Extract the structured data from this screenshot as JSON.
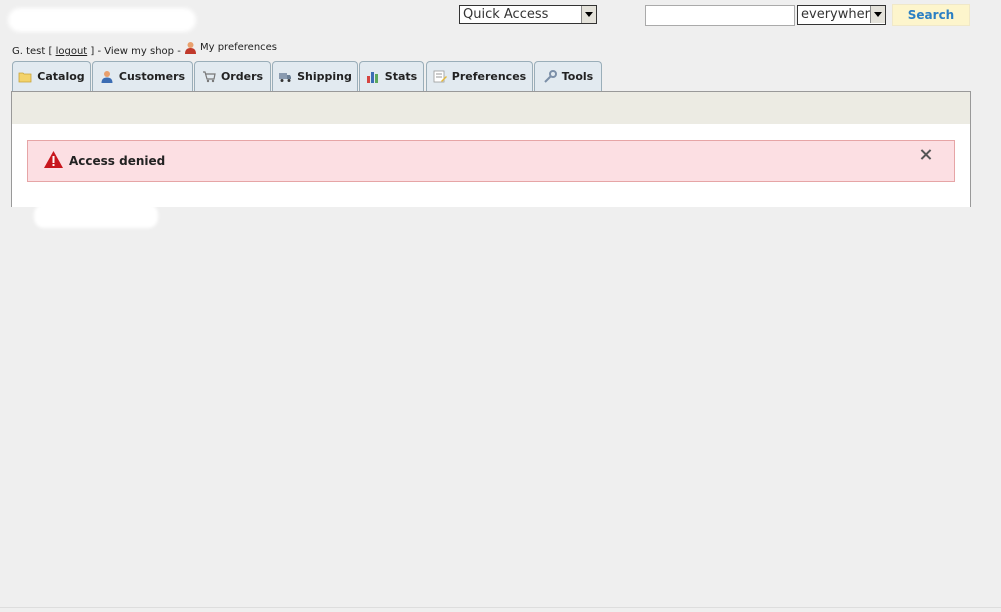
{
  "header": {
    "user_name": "G. test",
    "logout_label": "logout",
    "view_shop_label": "View my shop",
    "preferences_label": "My preferences"
  },
  "quick_access": {
    "value": "Quick Access"
  },
  "search": {
    "value": "",
    "scope": "everywhere",
    "button_label": "Search"
  },
  "tabs": [
    {
      "label": "Catalog",
      "icon": "folder-icon"
    },
    {
      "label": "Customers",
      "icon": "customer-icon"
    },
    {
      "label": "Orders",
      "icon": "cart-icon"
    },
    {
      "label": "Shipping",
      "icon": "truck-icon"
    },
    {
      "label": "Stats",
      "icon": "bar-chart-icon"
    },
    {
      "label": "Preferences",
      "icon": "settings-sheet-icon"
    },
    {
      "label": "Tools",
      "icon": "wrench-icon"
    }
  ],
  "alert": {
    "message": "Access denied",
    "icon": "warning-triangle-icon"
  },
  "colors": {
    "search_button_text": "#2a7fc4",
    "alert_bg": "#fcdfe3",
    "tab_bg": "#e2eaf0"
  }
}
